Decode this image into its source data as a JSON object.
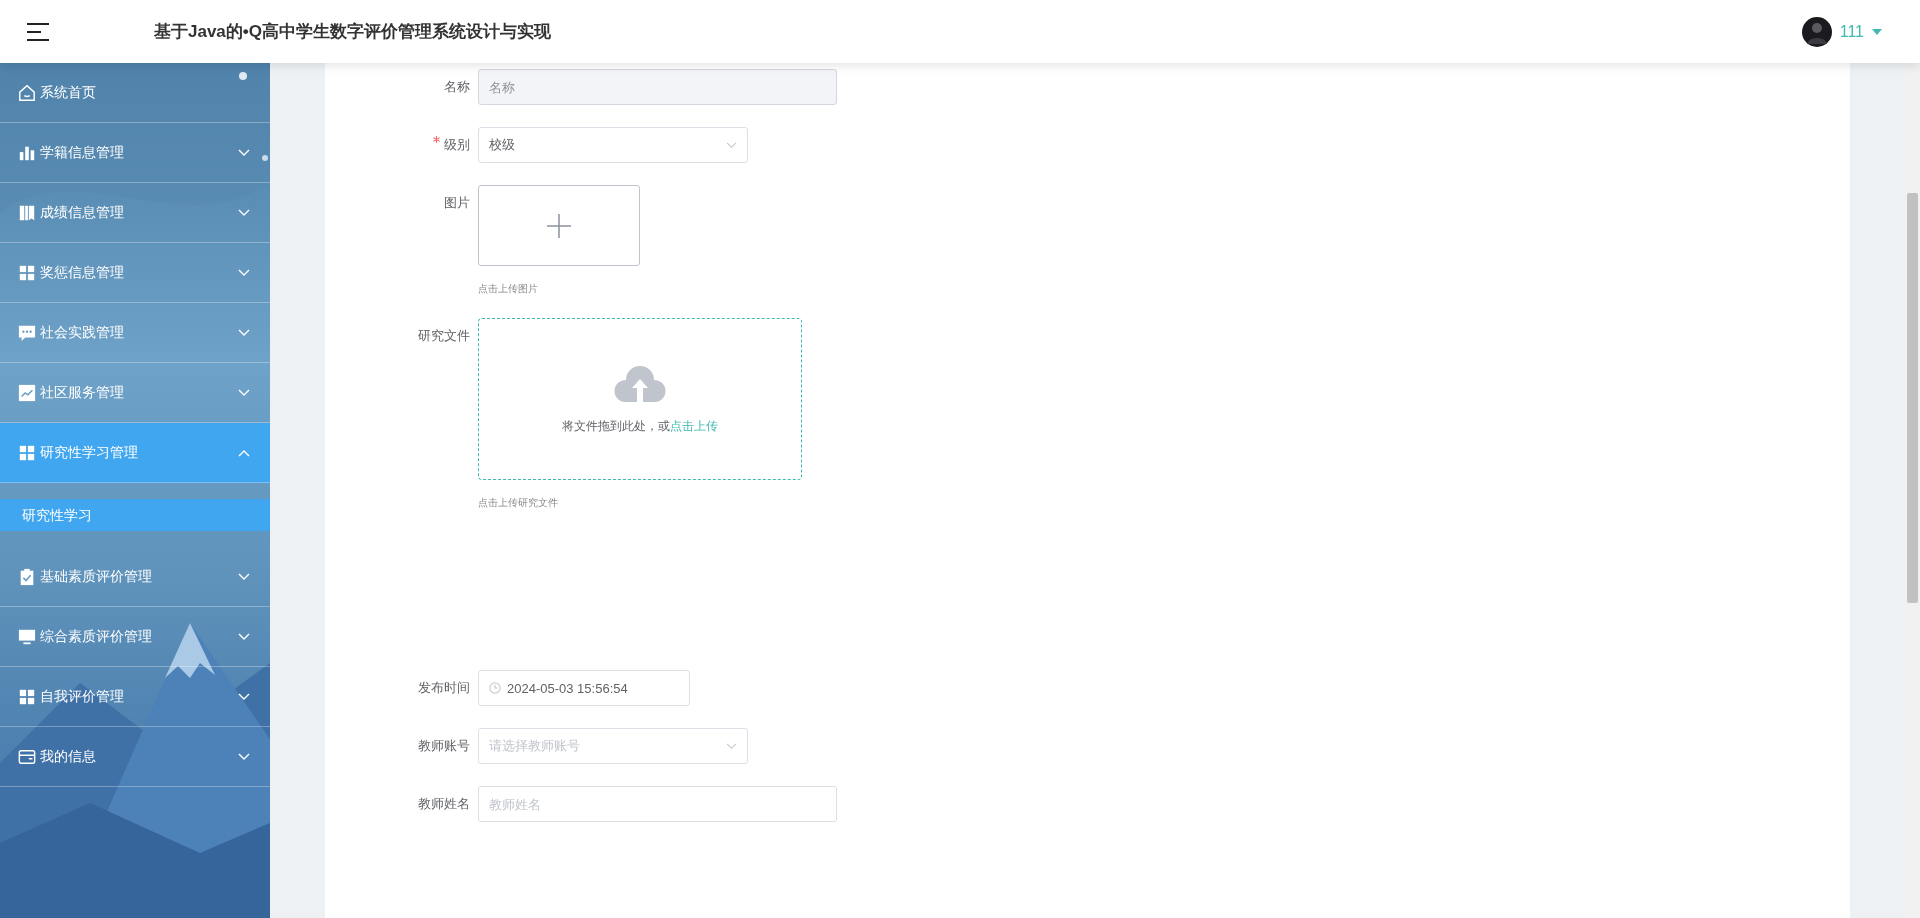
{
  "header": {
    "title": "基于Java的•Q高中学生数字评价管理系统设计与实现",
    "user": "111"
  },
  "sidebar": {
    "items": [
      {
        "label": "系统首页",
        "kind": "link",
        "selected": false
      },
      {
        "label": "学籍信息管理",
        "kind": "submenu",
        "expanded": false,
        "selected": false
      },
      {
        "label": "成绩信息管理",
        "kind": "submenu",
        "expanded": false,
        "selected": false
      },
      {
        "label": "奖惩信息管理",
        "kind": "submenu",
        "expanded": false,
        "selected": false
      },
      {
        "label": "社会实践管理",
        "kind": "submenu",
        "expanded": false,
        "selected": false
      },
      {
        "label": "社区服务管理",
        "kind": "submenu",
        "expanded": false,
        "selected": false
      },
      {
        "label": "研究性学习管理",
        "kind": "submenu",
        "expanded": true,
        "selected": true,
        "children": [
          {
            "label": "研究性学习",
            "selected": true
          }
        ]
      },
      {
        "label": "基础素质评价管理",
        "kind": "submenu",
        "expanded": false,
        "selected": false
      },
      {
        "label": "综合素质评价管理",
        "kind": "submenu",
        "expanded": false,
        "selected": false
      },
      {
        "label": "自我评价管理",
        "kind": "submenu",
        "expanded": false,
        "selected": false
      },
      {
        "label": "我的信息",
        "kind": "submenu",
        "expanded": false,
        "selected": false
      }
    ]
  },
  "form": {
    "fields": [
      {
        "kind": "input",
        "label": "名称",
        "required": false,
        "placeholder": "名称",
        "disabled": true
      },
      {
        "kind": "select",
        "label": "级别",
        "required": true,
        "value": "校级"
      },
      {
        "kind": "image-upload",
        "label": "图片",
        "required": false,
        "hint": "点击上传图片"
      },
      {
        "kind": "file-upload",
        "label": "研究文件",
        "required": false,
        "drop_text": "将文件拖到此处，或",
        "link": "点击上传",
        "hint": "点击上传研究文件"
      },
      {
        "kind": "datetime",
        "label": "发布时间",
        "required": false,
        "value": "2024-05-03 15:56:54"
      },
      {
        "kind": "select",
        "label": "教师账号",
        "required": false,
        "placeholder": "请选择教师账号"
      },
      {
        "kind": "input",
        "label": "教师姓名",
        "required": false,
        "placeholder": "教师姓名",
        "disabled": false
      }
    ]
  }
}
